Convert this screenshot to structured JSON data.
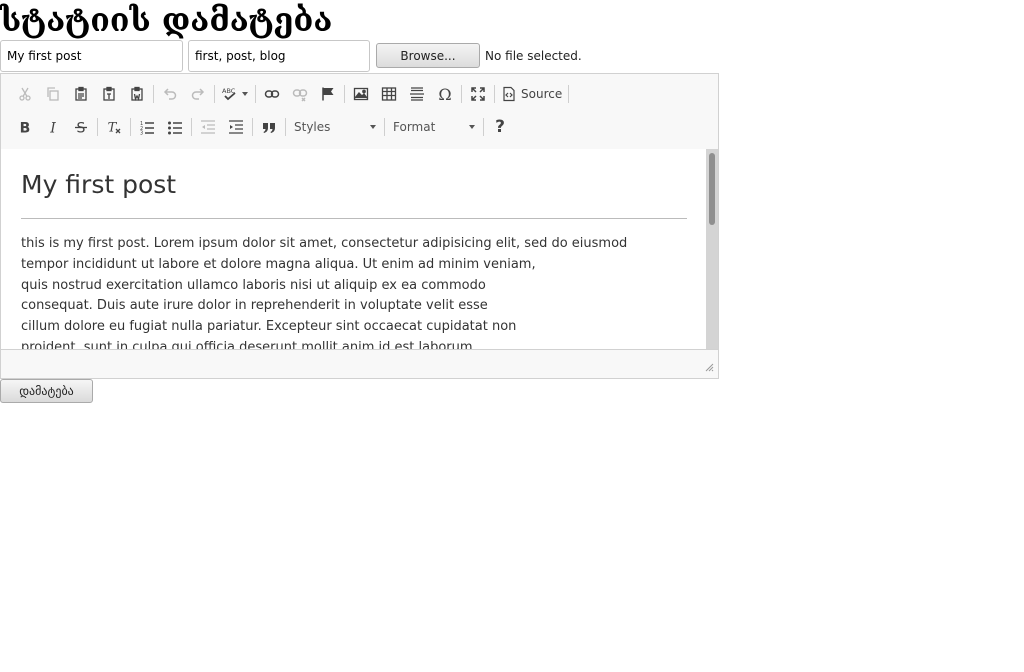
{
  "page": {
    "title": "სტატიის დამატება"
  },
  "form": {
    "title_value": "My first post",
    "tags_value": "first, post, blog",
    "browse_label": "Browse...",
    "file_status": "No file selected.",
    "submit_label": "დამატება"
  },
  "toolbar": {
    "row1": [
      "cut-icon",
      "copy-icon",
      "paste-icon",
      "paste-text-icon",
      "paste-word-icon",
      "undo-icon",
      "redo-icon",
      "spellcheck-icon",
      "link-icon",
      "unlink-icon",
      "anchor-icon",
      "image-icon",
      "table-icon",
      "horizontal-rule-icon",
      "special-char-icon",
      "maximize-icon",
      "source-icon"
    ],
    "row2": [
      "bold-icon",
      "italic-icon",
      "strikethrough-icon",
      "remove-format-icon",
      "numbered-list-icon",
      "bulleted-list-icon",
      "outdent-icon",
      "indent-icon",
      "blockquote-icon",
      "help-icon"
    ],
    "source_label": "Source",
    "styles_label": "Styles",
    "format_label": "Format",
    "help_label": "?"
  },
  "editor": {
    "heading": "My first post",
    "body_lines": [
      "this is my first post. Lorem ipsum dolor sit amet, consectetur adipisicing elit, sed do eiusmod",
      "tempor incididunt ut labore et dolore magna aliqua. Ut enim ad minim veniam,",
      "quis nostrud exercitation ullamco laboris nisi ut aliquip ex ea commodo",
      "consequat. Duis aute irure dolor in reprehenderit in voluptate velit esse",
      "cillum dolore eu fugiat nulla pariatur. Excepteur sint occaecat cupidatat non",
      "proident, sunt in culpa qui officia deserunt mollit anim id est laborum."
    ]
  },
  "colors": {
    "border": "#d1d1d1",
    "toolbar_bg": "#f8f8f8",
    "text": "#333333"
  }
}
